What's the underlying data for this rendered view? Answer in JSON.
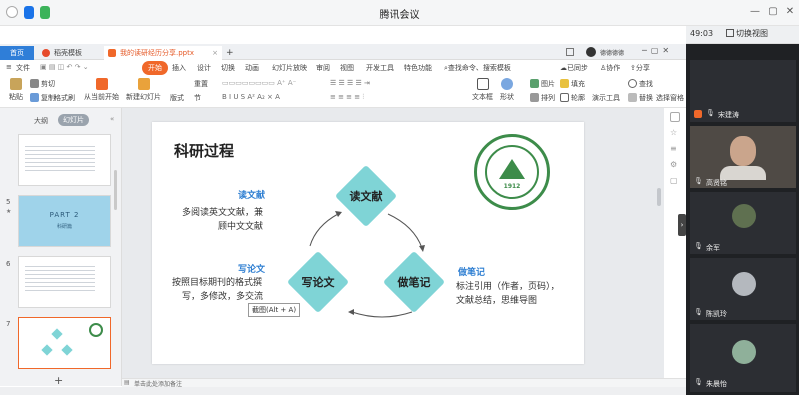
{
  "meeting": {
    "title": "腾讯会议",
    "time": "49:03",
    "switch_view": "切换视图"
  },
  "wps_tabs": {
    "home": "首页",
    "template": "稻壳模板",
    "file": "我的读研经历分享.pptx",
    "add": "+",
    "user": "德德德德"
  },
  "menu": {
    "file": "文件",
    "start": "开始",
    "insert": "插入",
    "design": "设计",
    "transition": "切换",
    "animation": "动画",
    "slideshow": "幻灯片放映",
    "review": "审阅",
    "view": "视图",
    "devtools": "开发工具",
    "special": "特色功能",
    "search": "查找命令、搜索模板",
    "sync": "已同步",
    "collab": "协作",
    "share": "分享"
  },
  "ribbon": {
    "paste": "粘贴",
    "cut": "剪切",
    "copy": "复制",
    "format_painter": "格式刷",
    "from_current": "从当前开始",
    "new_slide": "新建幻灯片",
    "layout": "版式",
    "section": "节",
    "reset": "重置",
    "textbox": "文本框",
    "shape": "形状",
    "arrange": "排列",
    "outline": "轮廓",
    "image": "图片",
    "fill": "填充",
    "presentation_tools": "演示工具",
    "replace": "替换",
    "select": "选择",
    "find": "查找",
    "select_pane": "选择窗格"
  },
  "left_panel": {
    "tab_outline": "大纲",
    "tab_slides": "幻灯片",
    "slide5_title": "PART 2",
    "slide5_sub": "科研篇",
    "slide_numbers": [
      "5",
      "6",
      "7"
    ],
    "add": "+"
  },
  "slide": {
    "title": "科研过程",
    "seal_year": "1912",
    "read_heading": "读文献",
    "read_body1": "多阅读英文文献，兼",
    "read_body2": "顾中文文献",
    "write_heading": "写论文",
    "write_body1": "按照目标期刊的格式撰",
    "write_body2": "写，多修改，多交流",
    "note_heading": "做笔记",
    "note_body1": "标注引用（作者，页码），",
    "note_body2": "文献总结，思维导图",
    "d_read": "读文献",
    "d_note": "做笔记",
    "d_write": "写论文",
    "tooltip": "截图(Alt + A)"
  },
  "notes_placeholder": "单击此处添加备注",
  "participants": [
    {
      "name": "宋建涛"
    },
    {
      "name": "高贤铭"
    },
    {
      "name": "余军"
    },
    {
      "name": "陈凯玲"
    },
    {
      "name": "朱晨怡"
    }
  ],
  "colors": {
    "diamond": "#7fd4d6",
    "heading_blue": "#2f7fd2",
    "wps_orange": "#f0682a",
    "video_bg": "#1f2124"
  }
}
